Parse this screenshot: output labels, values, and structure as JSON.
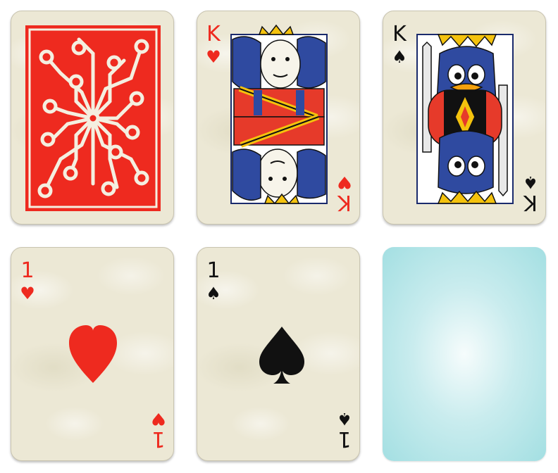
{
  "colors": {
    "felt": "#ffffff",
    "card_face": "#ece8d5",
    "card_back": "#ee2a1f",
    "red_suit": "#ee2a1f",
    "black_suit": "#111111",
    "empty_slot": "#a3dfe2"
  },
  "cards": [
    {
      "id": "card-back",
      "face_up": false,
      "back_pattern": "circuit"
    },
    {
      "id": "king-of-hearts",
      "face_up": true,
      "rank": "K",
      "suit": "heart",
      "suit_glyph": "♥",
      "color": "red"
    },
    {
      "id": "king-of-spades",
      "face_up": true,
      "rank": "K",
      "suit": "spade",
      "suit_glyph": "♠",
      "color": "black"
    },
    {
      "id": "ace-of-hearts",
      "face_up": true,
      "rank": "1",
      "suit": "heart",
      "suit_glyph": "♥",
      "color": "red"
    },
    {
      "id": "ace-of-spades",
      "face_up": true,
      "rank": "1",
      "suit": "spade",
      "suit_glyph": "♠",
      "color": "black"
    },
    {
      "id": "empty-slot",
      "face_up": false,
      "empty": true
    }
  ]
}
